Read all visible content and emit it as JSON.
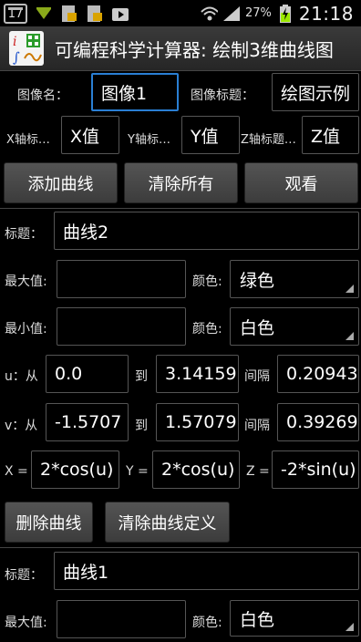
{
  "status_bar": {
    "calendar_day": "17",
    "battery_percent": "27%",
    "time": "21:18"
  },
  "app": {
    "title": "可编程科学计算器: 绘制3维曲线图"
  },
  "graph": {
    "name_label": "图像名：",
    "name_value": "图像1",
    "title_label": "图像标题：",
    "title_value": "绘图示例"
  },
  "axes": {
    "x_label": "X轴标…",
    "x_value": "X值",
    "y_label": "Y轴标…",
    "y_value": "Y值",
    "z_label": "Z轴标题…",
    "z_value": "Z值"
  },
  "actions": {
    "add_curve": "添加曲线",
    "clear_all": "清除所有",
    "view": "观看"
  },
  "curve2": {
    "title_label": "标题：",
    "title_value": "曲线2",
    "max_label": "最大值:",
    "max_value": "",
    "color_label": "颜色:",
    "max_color": "绿色",
    "min_label": "最小值:",
    "min_value": "",
    "min_color": "白色",
    "u_from_label": "u：从",
    "u_from": "0.0",
    "u_to_label": "到",
    "u_to": "3.14159",
    "u_step_label": "间隔",
    "u_step": "0.20943",
    "v_from_label": "v：从",
    "v_from": "-1.5707",
    "v_to_label": "到",
    "v_to": "1.57079",
    "v_step_label": "间隔",
    "v_step": "0.39269",
    "x_expr_label": "X =",
    "x_expr": "2*cos(u)",
    "y_expr_label": "Y =",
    "y_expr": "2*cos(u)",
    "z_expr_label": "Z =",
    "z_expr": "-2*sin(u)",
    "delete_label": "删除曲线",
    "clear_def_label": "清除曲线定义"
  },
  "curve1": {
    "title_label": "标题：",
    "title_value": "曲线1",
    "max_label": "最大值:",
    "max_value": "",
    "color_label": "颜色:",
    "max_color": "白色"
  },
  "colors": {
    "focus_border": "#2a7fd4",
    "background": "#000000",
    "button": "#4a4a4a",
    "battery_charging": "#9be800"
  }
}
